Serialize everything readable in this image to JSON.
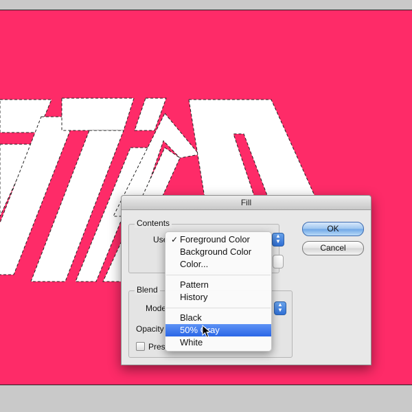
{
  "dialog": {
    "title": "Fill",
    "contents_legend": "Contents",
    "use_label": "Use",
    "blending_legend": "Blend",
    "mode_label": "Mode",
    "opacity_label": "Opacity",
    "preserve_label": "Pres",
    "ok_label": "OK",
    "cancel_label": "Cancel"
  },
  "menu": {
    "items": [
      {
        "label": "Foreground Color",
        "checked": true
      },
      {
        "label": "Background Color"
      },
      {
        "label": "Color..."
      },
      {
        "label": "Pattern"
      },
      {
        "label": "History"
      },
      {
        "label": "Black"
      },
      {
        "label": "50% Gray",
        "highlighted": true
      },
      {
        "label": "White"
      }
    ],
    "check_mark": "✓"
  },
  "colors": {
    "canvas": "#fe2b68",
    "highlight": "#2a66e6"
  }
}
